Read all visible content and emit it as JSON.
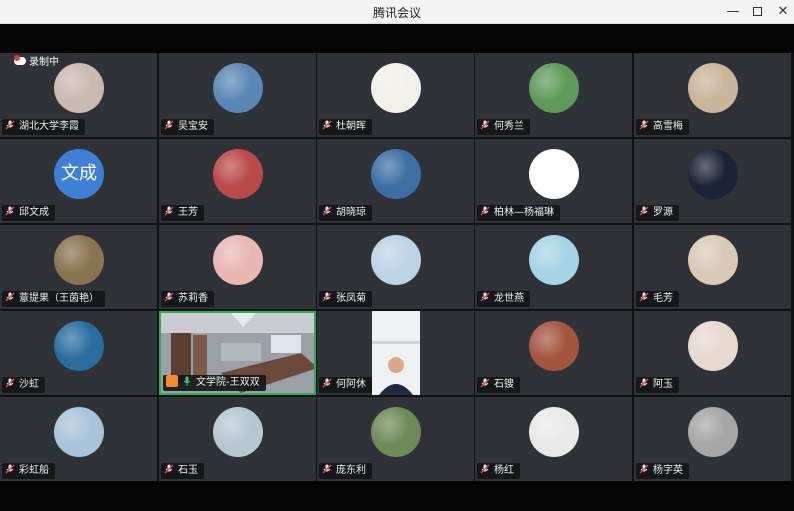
{
  "window": {
    "title": "腾讯会议"
  },
  "recording": {
    "label": "录制中"
  },
  "participants": [
    {
      "name": "湖北大学李霞",
      "avatar": "photo-hands-icon",
      "color": "#c9b9b0"
    },
    {
      "name": "吴宝安",
      "avatar": "photo-landscape-icon",
      "color": "#5a87b5"
    },
    {
      "name": "杜朝晖",
      "avatar": "photo-calligraphy-icon",
      "color": "#f2f0ea"
    },
    {
      "name": "何秀兰",
      "avatar": "photo-lotus-icon",
      "color": "#5f9a5a"
    },
    {
      "name": "高雪梅",
      "avatar": "photo-portrait-icon",
      "color": "#c8b59a"
    },
    {
      "name": "邱文成",
      "avatar": "text-avatar-icon",
      "avatar_text": "文成",
      "color": "#3f7fd6"
    },
    {
      "name": "王芳",
      "avatar": "photo-flowers-icon",
      "color": "#b84a4a"
    },
    {
      "name": "胡晓琼",
      "avatar": "photo-waterfall-icon",
      "color": "#3d6fa3"
    },
    {
      "name": "柏林—杨福琳",
      "avatar": "cartoon-girl-icon",
      "color": "#ffffff"
    },
    {
      "name": "罗源",
      "avatar": "photo-dragon-icon",
      "color": "#1b2436"
    },
    {
      "name": "薏提果（王茵艳）",
      "avatar": "photo-seed-icon",
      "color": "#8a7350"
    },
    {
      "name": "苏莉香",
      "avatar": "photo-pink-icon",
      "color": "#e8b7b4"
    },
    {
      "name": "张凤菊",
      "avatar": "photo-balloons-icon",
      "color": "#bcd3e6"
    },
    {
      "name": "龙世燕",
      "avatar": "cartoon-hat-girl-icon",
      "color": "#a7d4e5"
    },
    {
      "name": "毛芳",
      "avatar": "cartoon-boy-icon",
      "color": "#d9c9b6"
    },
    {
      "name": "沙虹",
      "avatar": "photo-sunflower-icon",
      "color": "#2a6ea0"
    },
    {
      "name": "文学院-王双双",
      "avatar": "video-room",
      "color": "#8b8f94",
      "active": true
    },
    {
      "name": "何阿休",
      "avatar": "video-person",
      "color": "#ebeef0"
    },
    {
      "name": "石锼",
      "avatar": "photo-track-icon",
      "color": "#a4553f"
    },
    {
      "name": "阿玉",
      "avatar": "photo-women-icon",
      "color": "#e7d8d0"
    },
    {
      "name": "彩虹船",
      "avatar": "photo-sky-icon",
      "color": "#a9c3d8"
    },
    {
      "name": "石玉",
      "avatar": "photo-beach-icon",
      "color": "#b7c7d2"
    },
    {
      "name": "庞东利",
      "avatar": "photo-couple-icon",
      "color": "#6e8a58"
    },
    {
      "name": "杨红",
      "avatar": "photo-woman-suit-icon",
      "color": "#e9e9e9"
    },
    {
      "name": "杨字英",
      "avatar": "photo-texture-icon",
      "color": "#a5a5a5"
    }
  ]
}
